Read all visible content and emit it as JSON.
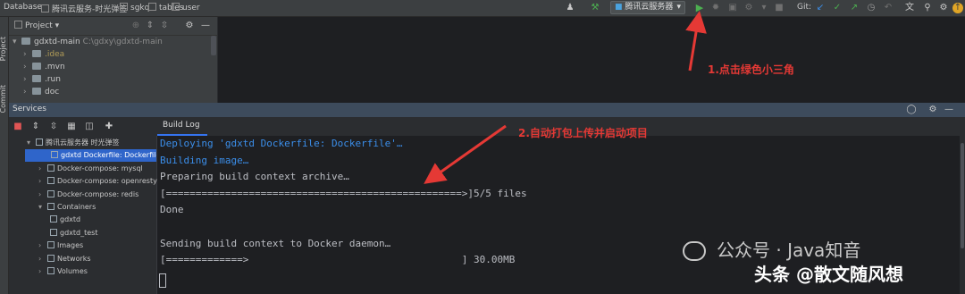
{
  "topbar": {
    "breadcrumbs": [
      "Database",
      "腾讯云服务-时光弹签",
      "sgkq",
      "tables",
      "user"
    ],
    "run_config": "腾讯云服务器",
    "git_label": "Git:"
  },
  "side_tabs": {
    "project": "Project",
    "commit": "Commit"
  },
  "project": {
    "header": "Project",
    "root_name": "gdxtd-main",
    "root_path": "C:\\gdxy\\gdxtd-main",
    "items": [
      ".idea",
      ".mvn",
      ".run",
      "doc"
    ]
  },
  "services": {
    "title": "Services",
    "tab": "Build Log",
    "tree": [
      {
        "label": "腾讯云服务器 时光弹签",
        "indent": 0,
        "expanded": true,
        "selected": false
      },
      {
        "label": "gdxtd Dockerfile: Dockerfile",
        "indent": 1,
        "expanded": false,
        "selected": true
      },
      {
        "label": "Docker-compose: mysql",
        "indent": 1,
        "expanded": false,
        "selected": false
      },
      {
        "label": "Docker-compose: openresty",
        "indent": 1,
        "expanded": false,
        "selected": false
      },
      {
        "label": "Docker-compose: redis",
        "indent": 1,
        "expanded": false,
        "selected": false
      },
      {
        "label": "Containers",
        "indent": 1,
        "expanded": true,
        "selected": false
      },
      {
        "label": "gdxtd",
        "indent": 2,
        "expanded": false,
        "selected": false
      },
      {
        "label": "gdxtd_test",
        "indent": 2,
        "expanded": false,
        "selected": false
      },
      {
        "label": "Images",
        "indent": 1,
        "expanded": false,
        "selected": false
      },
      {
        "label": "Networks",
        "indent": 1,
        "expanded": false,
        "selected": false
      },
      {
        "label": "Volumes",
        "indent": 1,
        "expanded": false,
        "selected": false
      }
    ]
  },
  "console": {
    "lines": [
      {
        "text": "Deploying 'gdxtd Dockerfile: Dockerfile'…",
        "style": "blue"
      },
      {
        "text": "Building image…",
        "style": "blue"
      },
      {
        "text": "Preparing build context archive…",
        "style": "plain"
      },
      {
        "text": "[==================================================>]5/5 files",
        "style": "plain"
      },
      {
        "text": "Done",
        "style": "plain"
      },
      {
        "text": "",
        "style": "plain"
      },
      {
        "text": "Sending build context to Docker daemon…",
        "style": "plain"
      },
      {
        "text": "[=============>                                    ] 30.00MB",
        "style": "plain"
      }
    ]
  },
  "annotations": {
    "step1": "1.点击绿色小三角",
    "step2": "2.自动打包上传并启动项目",
    "color": "#e53935"
  },
  "watermark": {
    "line1": "公众号 · Java知音",
    "line2": "头条 @散文随风想"
  },
  "colors": {
    "run_green": "#4caf50",
    "selection": "#2f65ca",
    "console_blue": "#3b8eea",
    "services_header": "#3d4b5c"
  }
}
